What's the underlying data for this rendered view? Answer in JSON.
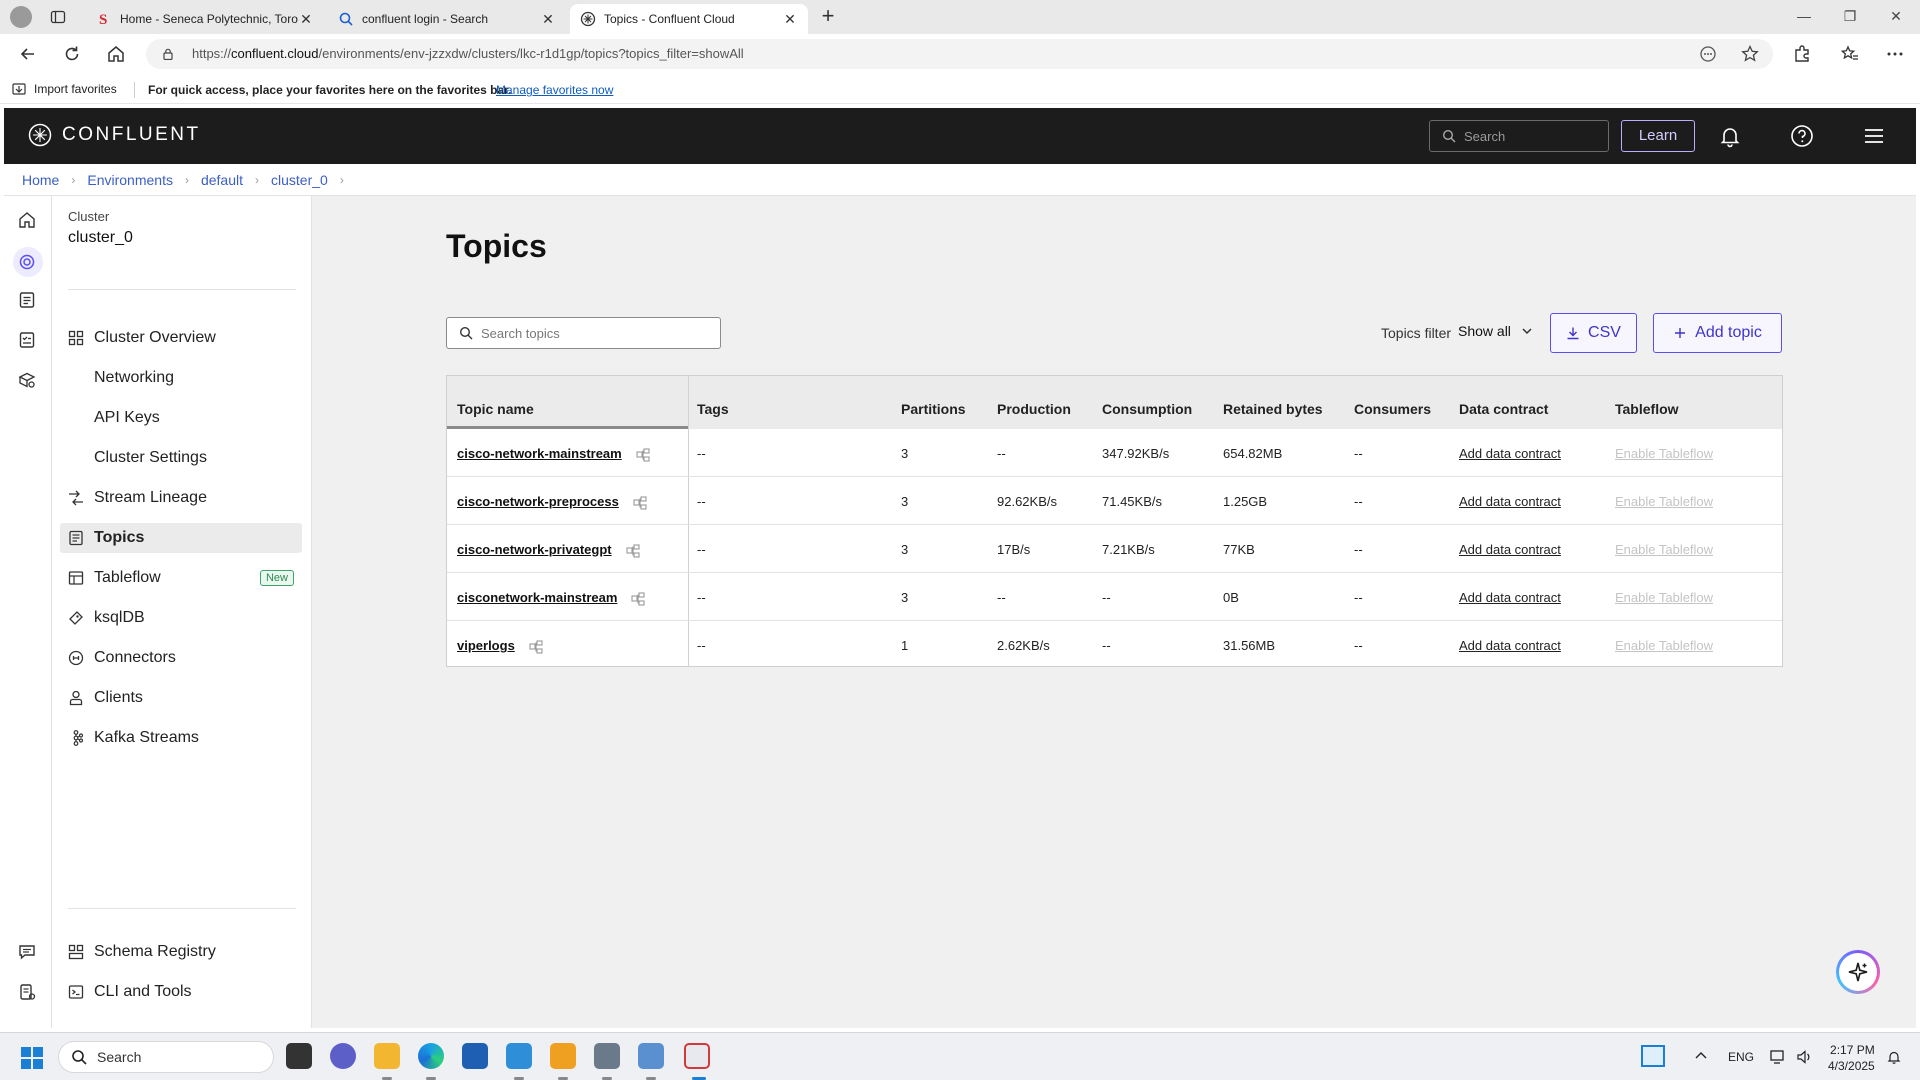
{
  "browser": {
    "tabs": [
      {
        "title": "Home - Seneca Polytechnic, Toronto",
        "icon": "seneca-s-icon"
      },
      {
        "title": "confluent login - Search",
        "icon": "search-icon"
      },
      {
        "title": "Topics - Confluent Cloud",
        "icon": "confluent-icon"
      }
    ],
    "url_prefix": "https://",
    "url_host": "confluent.cloud",
    "url_path": "/environments/env-jzzxdw/clusters/lkc-r1d1gp/topics?topics_filter=showAll",
    "favorites": {
      "import_label": "Import favorites",
      "prompt": "For quick access, place your favorites here on the favorites bar.",
      "manage_link": "Manage favorites now"
    }
  },
  "app": {
    "brand": "CONFLUENT",
    "search_placeholder": "Search",
    "learn_label": "Learn"
  },
  "breadcrumb": [
    "Home",
    "Environments",
    "default",
    "cluster_0"
  ],
  "sidebar": {
    "caption": "Cluster",
    "cluster_name": "cluster_0",
    "items": [
      {
        "label": "Cluster Overview",
        "icon": "grid-icon"
      },
      {
        "label": "Networking"
      },
      {
        "label": "API Keys"
      },
      {
        "label": "Cluster Settings"
      },
      {
        "label": "Stream Lineage",
        "icon": "lineage-icon"
      },
      {
        "label": "Topics",
        "icon": "topics-icon",
        "active": true
      },
      {
        "label": "Tableflow",
        "icon": "tableflow-icon",
        "badge": "New"
      },
      {
        "label": "ksqlDB",
        "icon": "ksqldb-icon"
      },
      {
        "label": "Connectors",
        "icon": "connectors-icon"
      },
      {
        "label": "Clients",
        "icon": "clients-icon"
      },
      {
        "label": "Kafka Streams",
        "icon": "kafka-streams-icon"
      }
    ],
    "bottom_items": [
      {
        "label": "Schema Registry",
        "icon": "schema-registry-icon"
      },
      {
        "label": "CLI and Tools",
        "icon": "cli-icon"
      }
    ]
  },
  "main": {
    "title": "Topics",
    "search_placeholder": "Search topics",
    "filter_label": "Topics filter",
    "filter_value": "Show all",
    "csv_label": "CSV",
    "add_topic_label": "Add topic",
    "columns": [
      "Topic name",
      "Tags",
      "Partitions",
      "Production",
      "Consumption",
      "Retained bytes",
      "Consumers",
      "Data contract",
      "Tableflow"
    ],
    "rows": [
      {
        "name": "cisco-network-mainstream",
        "tags": "--",
        "partitions": "3",
        "production": "--",
        "consumption": "347.92KB/s",
        "retained": "654.82MB",
        "consumers": "--",
        "contract": "Add data contract",
        "tableflow": "Enable Tableflow"
      },
      {
        "name": "cisco-network-preprocess",
        "tags": "--",
        "partitions": "3",
        "production": "92.62KB/s",
        "consumption": "71.45KB/s",
        "retained": "1.25GB",
        "consumers": "--",
        "contract": "Add data contract",
        "tableflow": "Enable Tableflow"
      },
      {
        "name": "cisco-network-privategpt",
        "tags": "--",
        "partitions": "3",
        "production": "17B/s",
        "consumption": "7.21KB/s",
        "retained": "77KB",
        "consumers": "--",
        "contract": "Add data contract",
        "tableflow": "Enable Tableflow"
      },
      {
        "name": "cisconetwork-mainstream",
        "tags": "--",
        "partitions": "3",
        "production": "--",
        "consumption": "--",
        "retained": "0B",
        "consumers": "--",
        "contract": "Add data contract",
        "tableflow": "Enable Tableflow"
      },
      {
        "name": "viperlogs",
        "tags": "--",
        "partitions": "1",
        "production": "2.62KB/s",
        "consumption": "--",
        "retained": "31.56MB",
        "consumers": "--",
        "contract": "Add data contract",
        "tableflow": "Enable Tableflow"
      }
    ]
  },
  "taskbar": {
    "search_label": "Search",
    "language": "ENG",
    "time": "2:17 PM",
    "date": "4/3/2025"
  },
  "colors": {
    "accent": "#5b4ef0",
    "nav_bg": "#1c1c1c",
    "content_bg": "#f0f0f0",
    "new_badge": "#2e8b57"
  }
}
